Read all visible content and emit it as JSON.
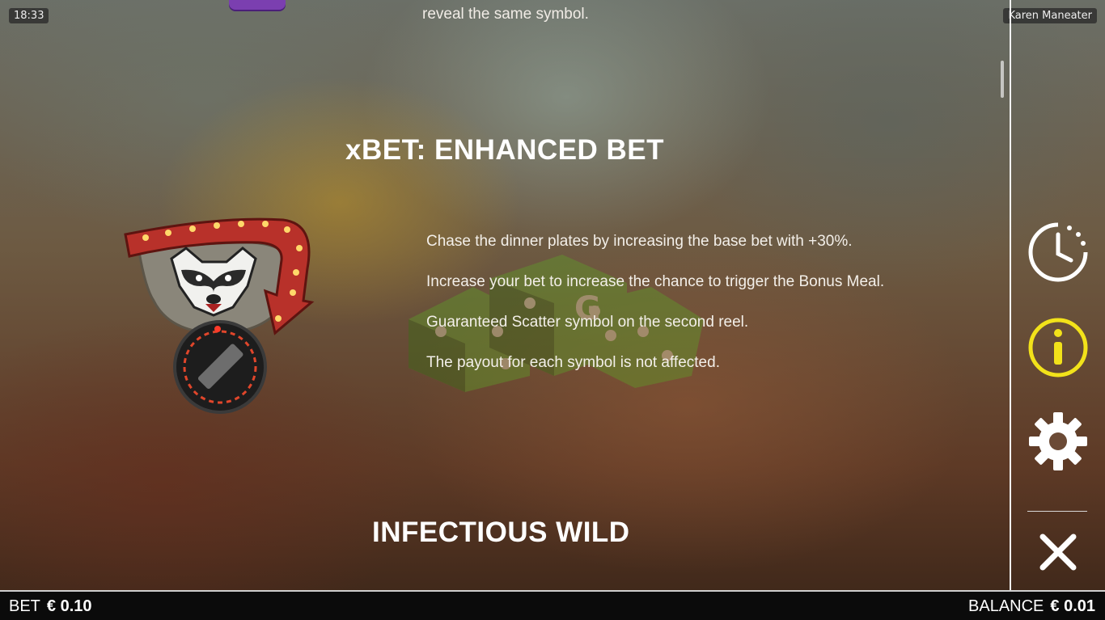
{
  "status": {
    "time": "18:33",
    "game_title": "Karen Maneater"
  },
  "content": {
    "top_snippet": "reveal the same symbol.",
    "xbet": {
      "title": "xBET: ENHANCED BET",
      "paragraphs": [
        "Chase the dinner plates by increasing the base bet with +30%.",
        "Increase your bet to increase the chance to trigger the Bonus Meal.",
        "Guaranteed Scatter symbol on the second reel.",
        "The payout for each symbol is not affected."
      ]
    },
    "next_section_title": "INFECTIOUS WILD"
  },
  "side_menu": {
    "items": [
      {
        "name": "history",
        "icon": "clock-icon"
      },
      {
        "name": "info",
        "icon": "info-icon",
        "active": true
      },
      {
        "name": "settings",
        "icon": "gear-icon"
      },
      {
        "name": "close",
        "icon": "close-icon"
      }
    ]
  },
  "footer": {
    "bet_label": "BET",
    "bet_value": "€  0.10",
    "balance_label": "BALANCE",
    "balance_value": "€  0.01"
  },
  "colors": {
    "accent_yellow": "#f2e21a",
    "icon_white": "#ffffff",
    "footer_bg": "#0b0b0b"
  }
}
